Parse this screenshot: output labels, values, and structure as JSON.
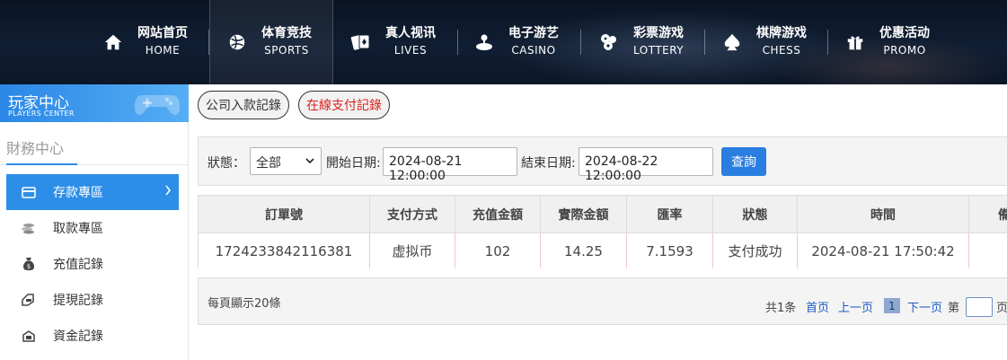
{
  "nav": {
    "items": [
      {
        "zh": "网站首页",
        "en": "HOME",
        "icon": "home-icon"
      },
      {
        "zh": "体育竞技",
        "en": "SPORTS",
        "icon": "ball-icon"
      },
      {
        "zh": "真人视讯",
        "en": "LIVES",
        "icon": "cards-icon"
      },
      {
        "zh": "电子游艺",
        "en": "CASINO",
        "icon": "joystick-icon"
      },
      {
        "zh": "彩票游戏",
        "en": "LOTTERY",
        "icon": "lottery-balls-icon"
      },
      {
        "zh": "棋牌游戏",
        "en": "CHESS",
        "icon": "spade-icon"
      },
      {
        "zh": "优惠活动",
        "en": "PROMO",
        "icon": "gift-icon"
      }
    ],
    "active": "SPORTS"
  },
  "sidebar": {
    "banner_zh": "玩家中心",
    "banner_en": "PLAYERS CENTER",
    "section_title": "財務中心",
    "items": [
      {
        "label": "存款專區",
        "icon": "card-icon"
      },
      {
        "label": "取款專區",
        "icon": "coins-icon"
      },
      {
        "label": "充值記錄",
        "icon": "money-bag-icon"
      },
      {
        "label": "提現記錄",
        "icon": "withdraw-icon"
      },
      {
        "label": "資金記錄",
        "icon": "funds-icon"
      }
    ],
    "active": "存款專區"
  },
  "tabs": {
    "company": "公司入款記錄",
    "online": "在線支付記錄",
    "online_color": "#d9201c"
  },
  "filter": {
    "status_label": "狀態：",
    "status_value": "全部",
    "start_label": "開始日期:",
    "start_value": "2024-08-21 12:00:00",
    "end_label": "結束日期:",
    "end_value": "2024-08-22 12:00:00",
    "query_label": "查詢"
  },
  "table": {
    "headers": [
      "訂單號",
      "支付方式",
      "充值金額",
      "實際金額",
      "匯率",
      "狀態",
      "時間",
      "備"
    ],
    "rows": [
      [
        "1724233842116381",
        "虚拟币",
        "102",
        "14.25",
        "7.1593",
        "支付成功",
        "2024-08-21 17:50:42",
        ""
      ]
    ]
  },
  "pager": {
    "per_page": "每頁顯示20條",
    "total": "共1条",
    "first": "首页",
    "prev": "上一页",
    "current": "1",
    "next": "下一页",
    "goto_prefix": "第",
    "goto_suffix": "页"
  },
  "colors": {
    "accent": "#2d8ee8",
    "query_button": "#2a7de1",
    "nav_bg": "#0f1b2e"
  }
}
